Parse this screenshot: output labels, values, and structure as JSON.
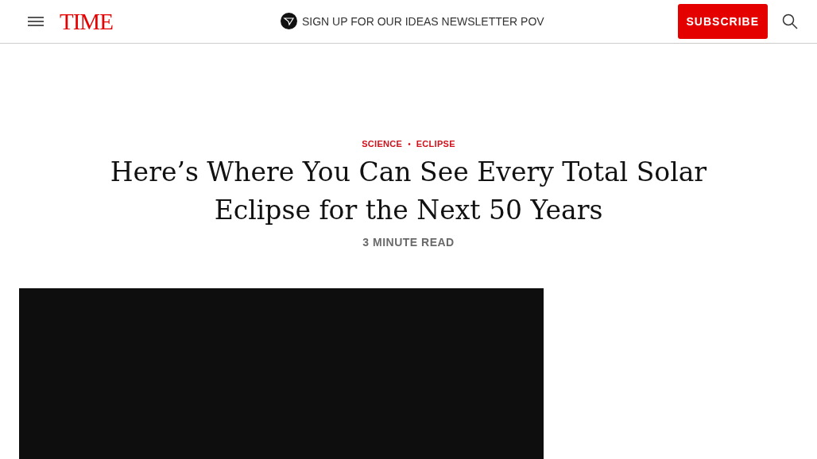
{
  "header": {
    "logo": "TIME",
    "newsletter": "SIGN UP FOR OUR IDEAS NEWSLETTER POV",
    "subscribe": "SUBSCRIBE"
  },
  "article": {
    "tags": [
      "SCIENCE",
      "ECLIPSE"
    ],
    "tag_separator": "•",
    "title": "Here’s Where You Can See Every Total Solar Eclipse for the Next 50 Years",
    "read_time": "3 MINUTE READ"
  }
}
